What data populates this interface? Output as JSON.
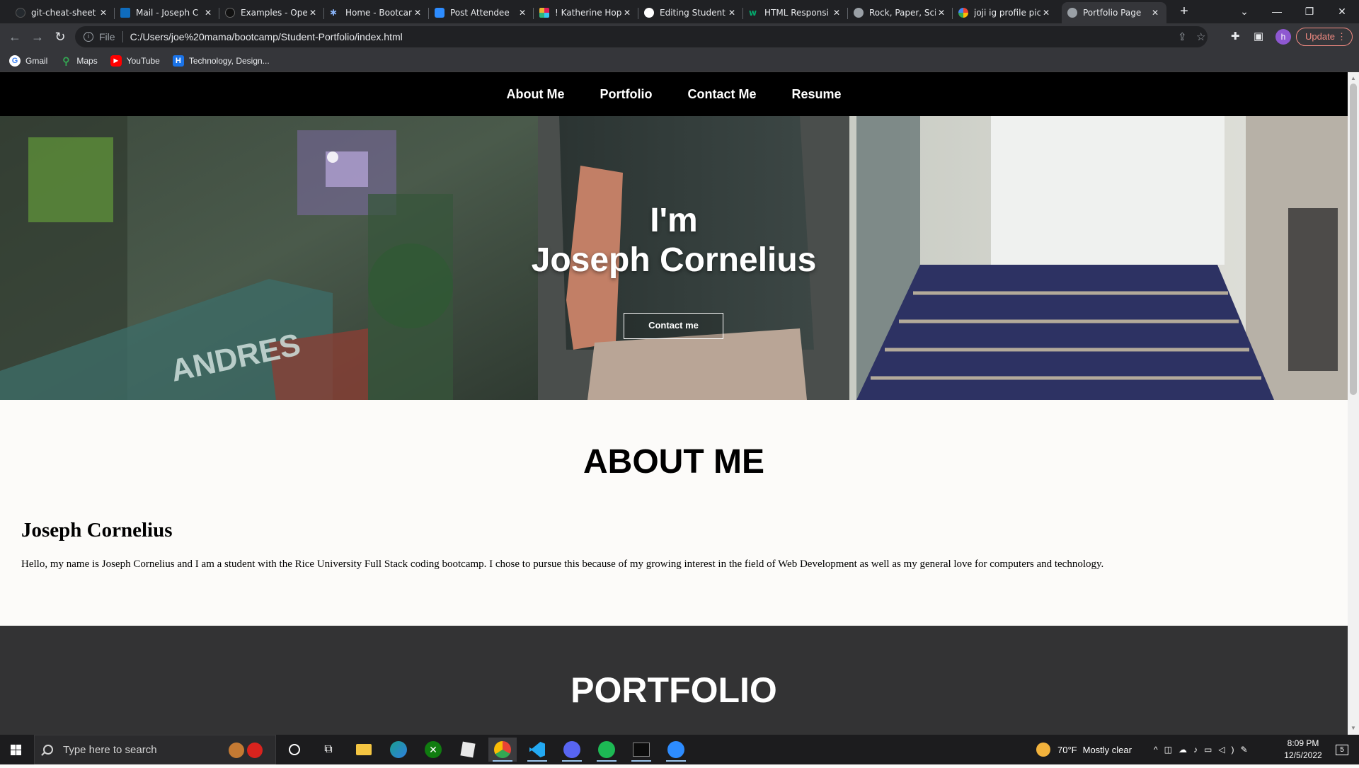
{
  "browser": {
    "tabs": [
      {
        "title": "git-cheat-sheet",
        "icon": "github-icon",
        "color": "#24292e"
      },
      {
        "title": "Mail - Joseph C",
        "icon": "outlook-icon",
        "color": "#0f6cbd"
      },
      {
        "title": "Examples - Ope",
        "icon": "openai-icon",
        "color": "#202124"
      },
      {
        "title": "Home - Bootcam",
        "icon": "bootcamp-icon",
        "color": "#8ab4f8"
      },
      {
        "title": "Post Attendee",
        "icon": "zoom-icon",
        "color": "#2d8cff"
      },
      {
        "title": "! Katherine Hop",
        "icon": "slack-icon",
        "color": "#e01e5a"
      },
      {
        "title": "Editing Student",
        "icon": "github-icon",
        "color": "#ffffff"
      },
      {
        "title": "HTML Responsi",
        "icon": "w3schools-icon",
        "color": "#04aa6d"
      },
      {
        "title": "Rock, Paper, Sci",
        "icon": "globe-icon",
        "color": "#9aa0a6"
      },
      {
        "title": "joji ig profile pic",
        "icon": "google-icon",
        "color": "#ffffff"
      },
      {
        "title": "Portfolio Page",
        "icon": "globe-icon",
        "color": "#9aa0a6",
        "active": true
      }
    ],
    "address": {
      "scheme_label": "File",
      "url": "C:/Users/joe%20mama/bootcamp/Student-Portfolio/index.html"
    },
    "profile_initial": "h",
    "update_label": "Update",
    "bookmarks": [
      {
        "label": "Gmail",
        "icon": "google-icon"
      },
      {
        "label": "Maps",
        "icon": "maps-icon"
      },
      {
        "label": "YouTube",
        "icon": "youtube-icon"
      },
      {
        "label": "Technology, Design...",
        "icon": "h-icon"
      }
    ]
  },
  "site": {
    "nav": [
      "About Me",
      "Portfolio",
      "Contact Me",
      "Resume"
    ],
    "hero": {
      "line1": "I'm",
      "line2": "Joseph Cornelius",
      "cta": "Contact me",
      "sign_text": "ANDRES"
    },
    "about": {
      "heading": "ABOUT ME",
      "name": "Joseph Cornelius",
      "bio": "Hello, my name is Joseph Cornelius and I am a student with the Rice University Full Stack coding bootcamp. I chose to pursue this because of my growing interest in the field of Web Development as well as my general love for computers and technology."
    },
    "portfolio": {
      "heading": "PORTFOLIO"
    }
  },
  "taskbar": {
    "search_placeholder": "Type here to search",
    "apps": [
      "cortana-icon",
      "task-view-icon",
      "file-explorer-icon",
      "edge-icon",
      "xbox-icon",
      "notes-icon",
      "chrome-icon",
      "vscode-icon",
      "discord-icon",
      "spotify-icon",
      "terminal-icon",
      "zoom-icon"
    ],
    "weather": {
      "temp": "70°F",
      "condition": "Mostly clear"
    },
    "time": "8:09 PM",
    "date": "12/5/2022",
    "notification_count": "5"
  }
}
